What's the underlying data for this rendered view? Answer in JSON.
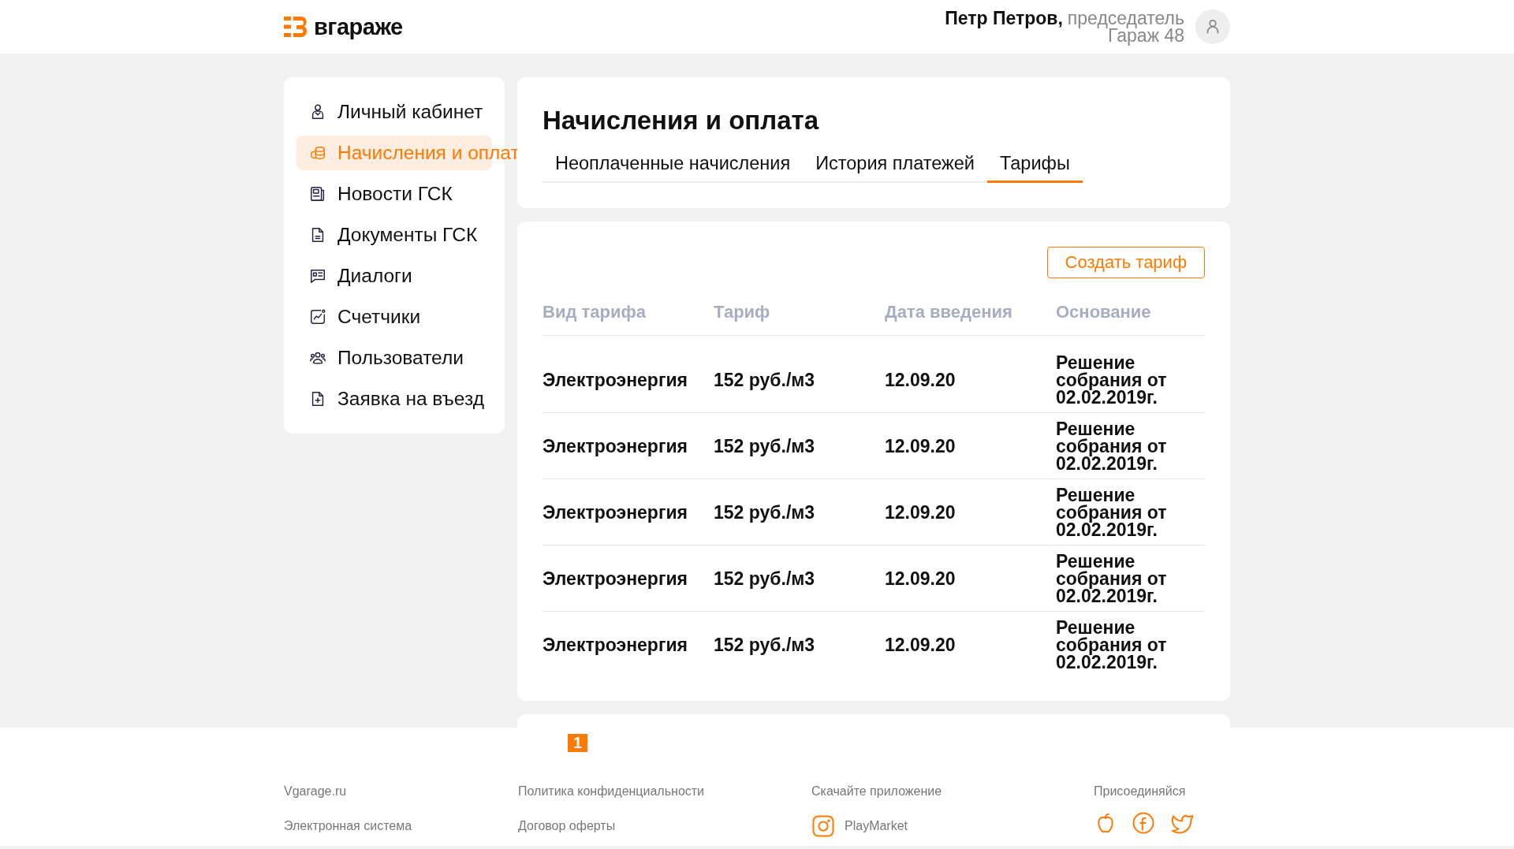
{
  "header": {
    "logo_text": "вгараже",
    "user_name": "Петр Петров,",
    "user_role": "председатель",
    "garage": "Гараж 48"
  },
  "sidebar": {
    "items": [
      {
        "label": "Личный кабинет",
        "selected": false
      },
      {
        "label": "Начисления и оплат",
        "selected": true
      },
      {
        "label": "Новости ГСК",
        "selected": false
      },
      {
        "label": "Документы ГСК",
        "selected": false
      },
      {
        "label": "Диалоги",
        "selected": false
      },
      {
        "label": "Счетчики",
        "selected": false
      },
      {
        "label": "Пользователи",
        "selected": false
      },
      {
        "label": "Заявка на въезд",
        "selected": false
      }
    ]
  },
  "page": {
    "title": "Начисления и оплата",
    "tabs": [
      {
        "label": "Неоплаченные начисления",
        "selected": false
      },
      {
        "label": "История платежей",
        "selected": false
      },
      {
        "label": "Тарифы",
        "selected": true
      }
    ]
  },
  "table": {
    "create_button": "Создать тариф",
    "columns": [
      "Вид тарифа",
      "Тариф",
      "Дата введения",
      "Основание"
    ],
    "rows": [
      [
        "Электроэнергия",
        "152 руб./м3",
        "12.09.20",
        "Решение собрания от 02.02.2019г."
      ],
      [
        "Электроэнергия",
        "152 руб./м3",
        "12.09.20",
        "Решение собрания от 02.02.2019г."
      ],
      [
        "Электроэнергия",
        "152 руб./м3",
        "12.09.20",
        "Решение собрания от 02.02.2019г."
      ],
      [
        "Электроэнергия",
        "152 руб./м3",
        "12.09.20",
        "Решение собрания от 02.02.2019г."
      ],
      [
        "Электроэнергия",
        "152 руб./м3",
        "12.09.20",
        "Решение собрания от 02.02.2019г."
      ]
    ]
  },
  "pagination": {
    "pages": [
      {
        "label": "1",
        "selected": true
      }
    ]
  },
  "footer": {
    "columns": [
      {
        "kind": "links",
        "items": [
          {
            "kind": "text",
            "text": "Vgarage.ru"
          },
          {
            "kind": "text",
            "text": "Электронная система"
          }
        ]
      },
      {
        "kind": "links",
        "items": [
          {
            "kind": "text",
            "text": "Политика конфиденциальности"
          },
          {
            "kind": "text",
            "text": "Договор оферты"
          }
        ]
      },
      {
        "kind": "links",
        "items": [
          {
            "kind": "text",
            "text": "Скачайте приложение"
          },
          {
            "kind": "app",
            "text": "PlayMarket"
          }
        ]
      },
      {
        "kind": "social",
        "items": [
          {
            "kind": "text",
            "text": "Присоединяйся"
          }
        ]
      }
    ]
  }
}
